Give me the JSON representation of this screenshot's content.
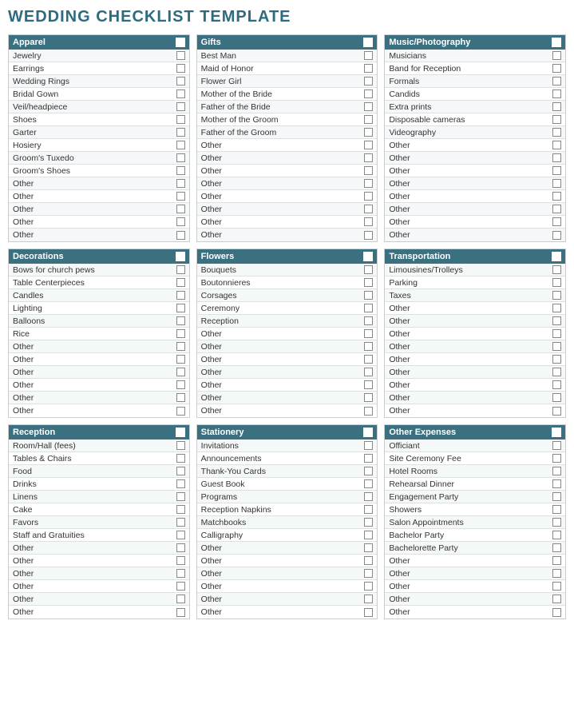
{
  "title": "WEDDING CHECKLIST TEMPLATE",
  "sections": [
    {
      "id": "apparel",
      "label": "Apparel",
      "items": [
        "Jewelry",
        "Earrings",
        "Wedding Rings",
        "Bridal Gown",
        "Veil/headpiece",
        "Shoes",
        "Garter",
        "Hosiery",
        "Groom's Tuxedo",
        "Groom's Shoes",
        "Other",
        "Other",
        "Other",
        "Other",
        "Other"
      ]
    },
    {
      "id": "gifts",
      "label": "Gifts",
      "items": [
        "Best Man",
        "Maid of Honor",
        "Flower Girl",
        "Mother of the Bride",
        "Father of the Bride",
        "Mother of the Groom",
        "Father of the Groom",
        "Other",
        "Other",
        "Other",
        "Other",
        "Other",
        "Other",
        "Other",
        "Other"
      ]
    },
    {
      "id": "music-photography",
      "label": "Music/Photography",
      "items": [
        "Musicians",
        "Band for Reception",
        "Formals",
        "Candids",
        "Extra prints",
        "Disposable cameras",
        "Videography",
        "Other",
        "Other",
        "Other",
        "Other",
        "Other",
        "Other",
        "Other",
        "Other"
      ]
    },
    {
      "id": "decorations",
      "label": "Decorations",
      "items": [
        "Bows for church pews",
        "Table Centerpieces",
        "Candles",
        "Lighting",
        "Balloons",
        "Rice",
        "Other",
        "Other",
        "Other",
        "Other",
        "Other",
        "Other"
      ]
    },
    {
      "id": "flowers",
      "label": "Flowers",
      "items": [
        "Bouquets",
        "Boutonnieres",
        "Corsages",
        "Ceremony",
        "Reception",
        "Other",
        "Other",
        "Other",
        "Other",
        "Other",
        "Other",
        "Other"
      ]
    },
    {
      "id": "transportation",
      "label": "Transportation",
      "items": [
        "Limousines/Trolleys",
        "Parking",
        "Taxes",
        "Other",
        "Other",
        "Other",
        "Other",
        "Other",
        "Other",
        "Other",
        "Other",
        "Other"
      ]
    },
    {
      "id": "reception",
      "label": "Reception",
      "items": [
        "Room/Hall (fees)",
        "Tables & Chairs",
        "Food",
        "Drinks",
        "Linens",
        "Cake",
        "Favors",
        "Staff and Gratuities",
        "Other",
        "Other",
        "Other",
        "Other",
        "Other",
        "Other"
      ]
    },
    {
      "id": "stationery",
      "label": "Stationery",
      "items": [
        "Invitations",
        "Announcements",
        "Thank-You Cards",
        "Guest Book",
        "Programs",
        "Reception Napkins",
        "Matchbooks",
        "Calligraphy",
        "Other",
        "Other",
        "Other",
        "Other",
        "Other",
        "Other"
      ]
    },
    {
      "id": "other-expenses",
      "label": "Other Expenses",
      "items": [
        "Officiant",
        "Site Ceremony Fee",
        "Hotel Rooms",
        "Rehearsal Dinner",
        "Engagement Party",
        "Showers",
        "Salon Appointments",
        "Bachelor Party",
        "Bachelorette Party",
        "Other",
        "Other",
        "Other",
        "Other",
        "Other"
      ]
    }
  ]
}
